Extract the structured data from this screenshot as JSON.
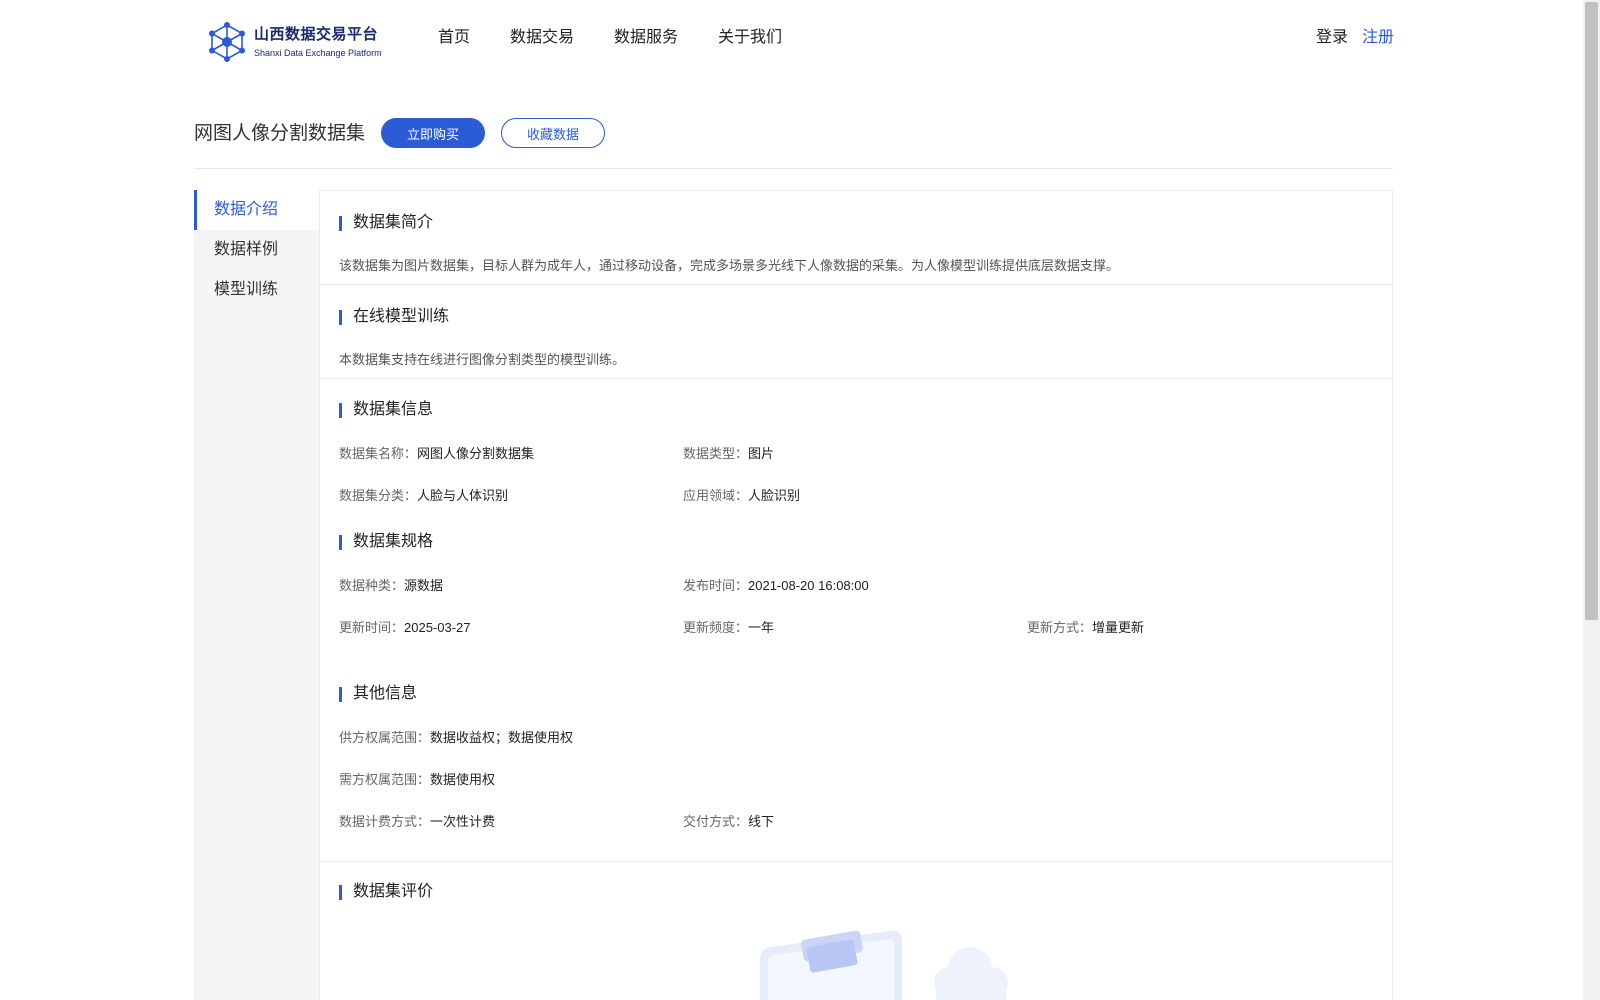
{
  "header": {
    "logo_cn": "山西数据交易平台",
    "logo_en": "Shanxi Data Exchange Platform",
    "nav": [
      "首页",
      "数据交易",
      "数据服务",
      "关于我们"
    ],
    "login": "登录",
    "register": "注册"
  },
  "title": {
    "text": "网图人像分割数据集",
    "buy_button": "立即购买",
    "favorite_button": "收藏数据"
  },
  "sidebar": {
    "items": [
      "数据介绍",
      "数据样例",
      "模型训练"
    ],
    "active_index": 0
  },
  "sections": {
    "intro": {
      "title": "数据集简介",
      "text": "该数据集为图片数据集，目标人群为成年人，通过移动设备，完成多场景多光线下人像数据的采集。为人像模型训练提供底层数据支撑。"
    },
    "training": {
      "title": "在线模型训练",
      "text": "本数据集支持在线进行图像分割类型的模型训练。"
    },
    "info": {
      "title": "数据集信息",
      "name_label": "数据集名称：",
      "name_value": "网图人像分割数据集",
      "type_label": "数据类型：",
      "type_value": "图片",
      "category_label": "数据集分类：",
      "category_value": "人脸与人体识别",
      "domain_label": "应用领域：",
      "domain_value": "人脸识别"
    },
    "spec": {
      "title": "数据集规格",
      "kind_label": "数据种类：",
      "kind_value": "源数据",
      "publish_label": "发布时间：",
      "publish_value": "2021-08-20 16:08:00",
      "updated_label": "更新时间：",
      "updated_value": "2025-03-27",
      "freq_label": "更新频度：",
      "freq_value": "一年",
      "method_label": "更新方式：",
      "method_value": "增量更新"
    },
    "other": {
      "title": "其他信息",
      "supplier_label": "供方权属范围：",
      "supplier_value": "数据收益权；数据使用权",
      "demand_label": "需方权属范围：",
      "demand_value": "数据使用权",
      "billing_label": "数据计费方式：",
      "billing_value": "一次性计费",
      "delivery_label": "交付方式：",
      "delivery_value": "线下"
    },
    "review": {
      "title": "数据集评价"
    }
  },
  "colors": {
    "accent": "#2b5bd7",
    "sidebar_bg": "#f4f5f7",
    "divider": "#ececec"
  }
}
